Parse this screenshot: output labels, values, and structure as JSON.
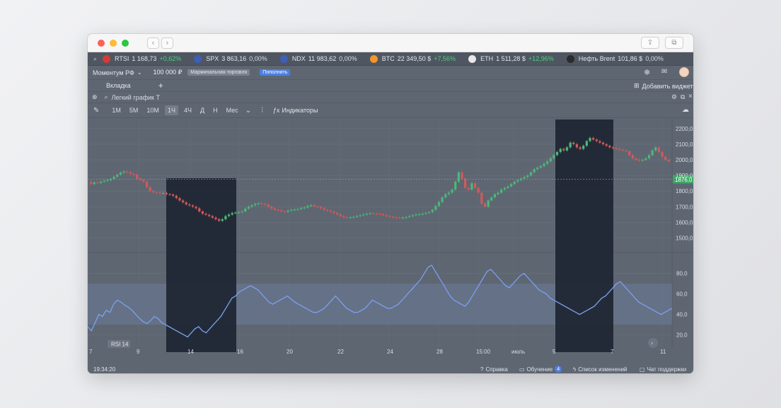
{
  "tickers": [
    {
      "icon": "russia-flag-icon",
      "name": "RTSI",
      "value": "1 168,73",
      "change": "+0,62%",
      "positive": true,
      "color": "#d33b3b"
    },
    {
      "icon": "usa-flag-icon",
      "name": "SPX",
      "value": "3 863,16",
      "change": "0,00%",
      "positive": false,
      "color": "#3c5fb8"
    },
    {
      "icon": "usa-flag-icon",
      "name": "NDX",
      "value": "11 983,62",
      "change": "0,00%",
      "positive": false,
      "color": "#3c5fb8"
    },
    {
      "icon": "bitcoin-icon",
      "name": "BTC",
      "value": "22 349,50 $",
      "change": "+7,56%",
      "positive": true,
      "color": "#f0962a"
    },
    {
      "icon": "ethereum-icon",
      "name": "ETH",
      "value": "1 511,28 $",
      "change": "+12,96%",
      "positive": true,
      "color": "#e8e8e8"
    },
    {
      "icon": "oil-barrel-icon",
      "name": "Нефть Brent",
      "value": "101,86 $",
      "change": "0,00%",
      "positive": false,
      "color": "#2b2b2b"
    }
  ],
  "account": {
    "name": "Моментум РФ",
    "balance": "100 000 ₽",
    "margin_badge": "Маржинальная торговля",
    "topup_button": "Пополнить"
  },
  "tabs": {
    "tab_label": "Вкладка",
    "add_label": "+",
    "add_widget": "Добавить виджет"
  },
  "widget": {
    "search_placeholder": "Легкий график Т"
  },
  "toolbar": {
    "timeframes": [
      "1М",
      "5М",
      "10М",
      "1Ч",
      "4Ч",
      "Д",
      "Н",
      "Мес"
    ],
    "active_index": 3,
    "indicators_label": "Индикаторы"
  },
  "chart_data": {
    "type": "candlestick",
    "price_axis_ticks": [
      "2200,0",
      "2100,0",
      "2000,0",
      "1900,0",
      "1800,0",
      "1700,0",
      "1600,0",
      "1500,0"
    ],
    "price_ylim": [
      1430,
      2240
    ],
    "current_price": "1876,0",
    "current_price_color": "#3aa864",
    "rsi_axis_ticks": [
      "80,0",
      "60,0",
      "40,0",
      "20,0"
    ],
    "rsi_ylim": [
      8,
      95
    ],
    "rsi_band": [
      30,
      70
    ],
    "rsi_label": "RSI 14",
    "x_tick_labels": [
      "7",
      "9",
      "14",
      "16",
      "20",
      "22",
      "24",
      "28",
      "15:00",
      "июль",
      "5",
      "7",
      "11"
    ],
    "price_series": [
      1860,
      1845,
      1856,
      1852,
      1860,
      1866,
      1870,
      1878,
      1892,
      1905,
      1918,
      1925,
      1922,
      1910,
      1905,
      1880,
      1872,
      1860,
      1825,
      1800,
      1792,
      1790,
      1786,
      1788,
      1780,
      1778,
      1770,
      1755,
      1740,
      1728,
      1715,
      1708,
      1700,
      1690,
      1670,
      1655,
      1648,
      1640,
      1630,
      1620,
      1610,
      1620,
      1640,
      1650,
      1660,
      1662,
      1665,
      1670,
      1688,
      1700,
      1710,
      1718,
      1722,
      1720,
      1715,
      1700,
      1688,
      1680,
      1678,
      1670,
      1668,
      1675,
      1680,
      1682,
      1685,
      1692,
      1695,
      1705,
      1710,
      1702,
      1698,
      1690,
      1680,
      1675,
      1668,
      1660,
      1650,
      1640,
      1632,
      1630,
      1632,
      1635,
      1640,
      1645,
      1650,
      1655,
      1658,
      1656,
      1655,
      1652,
      1645,
      1640,
      1636,
      1632,
      1630,
      1628,
      1630,
      1634,
      1640,
      1645,
      1650,
      1652,
      1655,
      1660,
      1665,
      1680,
      1705,
      1730,
      1760,
      1780,
      1790,
      1810,
      1860,
      1920,
      1880,
      1820,
      1810,
      1850,
      1820,
      1790,
      1720,
      1700,
      1740,
      1760,
      1780,
      1790,
      1810,
      1820,
      1830,
      1845,
      1860,
      1870,
      1880,
      1890,
      1900,
      1920,
      1940,
      1950,
      1960,
      1975,
      1990,
      2010,
      2030,
      2050,
      2070,
      2060,
      2080,
      2110,
      2100,
      2080,
      2070,
      2090,
      2120,
      2140,
      2130,
      2120,
      2110,
      2100,
      2090,
      2080,
      2075,
      2070,
      2065,
      2060,
      2055,
      2030,
      2010,
      2000,
      1995,
      2000,
      2010,
      2030,
      2060,
      2080,
      2050,
      2020,
      2000,
      1990
    ],
    "rsi_series": [
      28,
      24,
      32,
      40,
      38,
      44,
      42,
      50,
      54,
      52,
      49,
      47,
      44,
      40,
      36,
      33,
      31,
      34,
      38,
      36,
      32,
      30,
      28,
      26,
      24,
      22,
      20,
      18,
      22,
      26,
      28,
      24,
      22,
      26,
      30,
      34,
      38,
      44,
      50,
      56,
      58,
      62,
      64,
      66,
      68,
      66,
      64,
      60,
      56,
      52,
      50,
      52,
      54,
      56,
      58,
      55,
      52,
      50,
      48,
      46,
      44,
      42,
      42,
      44,
      46,
      50,
      54,
      58,
      54,
      50,
      46,
      44,
      42,
      42,
      44,
      46,
      50,
      54,
      52,
      50,
      48,
      46,
      46,
      48,
      50,
      54,
      58,
      62,
      66,
      70,
      74,
      80,
      86,
      88,
      82,
      76,
      70,
      64,
      58,
      54,
      52,
      50,
      48,
      52,
      58,
      64,
      70,
      76,
      82,
      84,
      80,
      76,
      72,
      68,
      66,
      70,
      74,
      78,
      80,
      76,
      72,
      68,
      64,
      62,
      60,
      56,
      54,
      52,
      50,
      48,
      46,
      44,
      42,
      40,
      42,
      44,
      46,
      48,
      52,
      56,
      58,
      62,
      66,
      70,
      72,
      68,
      64,
      60,
      56,
      52,
      50,
      48,
      46,
      44,
      42,
      40,
      42,
      44,
      46
    ]
  },
  "status": {
    "time": "19:34:20",
    "help": "Справка",
    "learning": "Обучение",
    "learning_count": "4",
    "changelog": "Список изменений",
    "support": "Чат поддержки"
  }
}
